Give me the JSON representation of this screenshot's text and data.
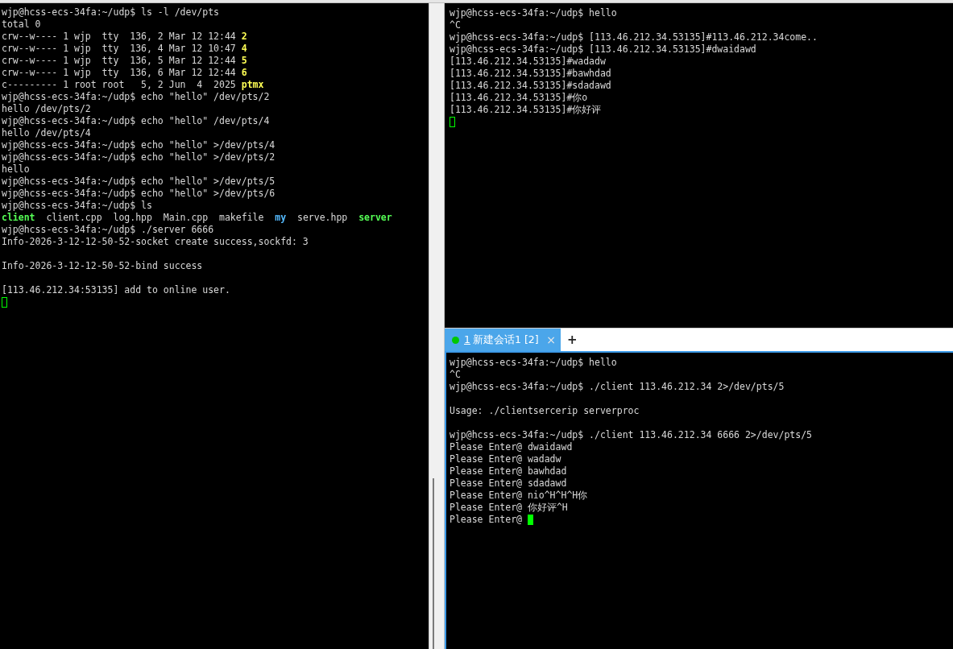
{
  "panes": [
    {
      "lines": [
        {
          "kind": "text",
          "text": "wjp@hcss-ecs-34fa:~/udp$ ls -l /dev/pts"
        },
        {
          "kind": "text",
          "text": "total 0"
        },
        {
          "kind": "segments",
          "segments": [
            {
              "text": "crw--w---- 1 wjp  tty  136, 2 Mar 12 12:44 ",
              "kind": "plain"
            },
            {
              "text": "2",
              "kind": "device"
            }
          ]
        },
        {
          "kind": "segments",
          "segments": [
            {
              "text": "crw--w---- 1 wjp  tty  136, 4 Mar 12 10:47 ",
              "kind": "plain"
            },
            {
              "text": "4",
              "kind": "device"
            }
          ]
        },
        {
          "kind": "segments",
          "segments": [
            {
              "text": "crw--w---- 1 wjp  tty  136, 5 Mar 12 12:44 ",
              "kind": "plain"
            },
            {
              "text": "5",
              "kind": "device"
            }
          ]
        },
        {
          "kind": "segments",
          "segments": [
            {
              "text": "crw--w---- 1 wjp  tty  136, 6 Mar 12 12:44 ",
              "kind": "plain"
            },
            {
              "text": "6",
              "kind": "device"
            }
          ]
        },
        {
          "kind": "segments",
          "segments": [
            {
              "text": "c--------- 1 root root   5, 2 Jun  4  2025 ",
              "kind": "plain"
            },
            {
              "text": "ptmx",
              "kind": "device"
            }
          ]
        },
        {
          "kind": "text",
          "text": "wjp@hcss-ecs-34fa:~/udp$ echo \"hello\" /dev/pts/2"
        },
        {
          "kind": "text",
          "text": "hello /dev/pts/2"
        },
        {
          "kind": "text",
          "text": "wjp@hcss-ecs-34fa:~/udp$ echo \"hello\" /dev/pts/4"
        },
        {
          "kind": "text",
          "text": "hello /dev/pts/4"
        },
        {
          "kind": "text",
          "text": "wjp@hcss-ecs-34fa:~/udp$ echo \"hello\" >/dev/pts/4"
        },
        {
          "kind": "text",
          "text": "wjp@hcss-ecs-34fa:~/udp$ echo \"hello\" >/dev/pts/2"
        },
        {
          "kind": "text",
          "text": "hello"
        },
        {
          "kind": "text",
          "text": "wjp@hcss-ecs-34fa:~/udp$ echo \"hello\" >/dev/pts/5"
        },
        {
          "kind": "text",
          "text": "wjp@hcss-ecs-34fa:~/udp$ echo \"hello\" >/dev/pts/6"
        },
        {
          "kind": "text",
          "text": "wjp@hcss-ecs-34fa:~/udp$ ls"
        },
        {
          "kind": "segments",
          "segments": [
            {
              "text": "client",
              "kind": "executable"
            },
            {
              "text": "  client.cpp  log.hpp  Main.cpp  makefile  ",
              "kind": "plain"
            },
            {
              "text": "my",
              "kind": "directory"
            },
            {
              "text": "  serve.hpp  ",
              "kind": "plain"
            },
            {
              "text": "server",
              "kind": "executable"
            }
          ]
        },
        {
          "kind": "text",
          "text": "wjp@hcss-ecs-34fa:~/udp$ ./server 6666"
        },
        {
          "kind": "text",
          "text": "Info-2026-3-12-12-50-52-socket create success,sockfd: 3"
        },
        {
          "kind": "blank"
        },
        {
          "kind": "text",
          "text": "Info-2026-3-12-12-50-52-bind success"
        },
        {
          "kind": "blank"
        },
        {
          "kind": "text",
          "text": "[113.46.212.34:53135] add to online user."
        },
        {
          "kind": "cursor",
          "filled": false
        }
      ]
    },
    {
      "lines": [
        {
          "kind": "text",
          "text": "wjp@hcss-ecs-34fa:~/udp$ hello"
        },
        {
          "kind": "text",
          "text": "^C"
        },
        {
          "kind": "text",
          "text": "wjp@hcss-ecs-34fa:~/udp$ [113.46.212.34.53135]#113.46.212.34come.."
        },
        {
          "kind": "text",
          "text": "wjp@hcss-ecs-34fa:~/udp$ [113.46.212.34.53135]#dwaidawd"
        },
        {
          "kind": "text",
          "text": "[113.46.212.34.53135]#wadadw"
        },
        {
          "kind": "text",
          "text": "[113.46.212.34.53135]#bawhdad"
        },
        {
          "kind": "text",
          "text": "[113.46.212.34.53135]#sdadawd"
        },
        {
          "kind": "text",
          "text": "[113.46.212.34.53135]#你o"
        },
        {
          "kind": "text",
          "text": "[113.46.212.34.53135]#你好评"
        },
        {
          "kind": "cursor",
          "filled": false
        }
      ]
    },
    {
      "tab": {
        "number": "1",
        "label": "新建会话1 [2]",
        "connected": true,
        "selected": true,
        "close": "×"
      },
      "new_tab": "+",
      "lines": [
        {
          "kind": "text",
          "text": "wjp@hcss-ecs-34fa:~/udp$ hello"
        },
        {
          "kind": "text",
          "text": "^C"
        },
        {
          "kind": "text",
          "text": "wjp@hcss-ecs-34fa:~/udp$ ./client 113.46.212.34 2>/dev/pts/5"
        },
        {
          "kind": "blank"
        },
        {
          "kind": "text",
          "text": "Usage: ./clientsercerip serverproc"
        },
        {
          "kind": "blank"
        },
        {
          "kind": "text",
          "text": "wjp@hcss-ecs-34fa:~/udp$ ./client 113.46.212.34 6666 2>/dev/pts/5"
        },
        {
          "kind": "text",
          "text": "Please Enter@ dwaidawd"
        },
        {
          "kind": "text",
          "text": "Please Enter@ wadadw"
        },
        {
          "kind": "text",
          "text": "Please Enter@ bawhdad"
        },
        {
          "kind": "text",
          "text": "Please Enter@ sdadawd"
        },
        {
          "kind": "text",
          "text": "Please Enter@ nio^H^H^H你"
        },
        {
          "kind": "text",
          "text": "Please Enter@ 你好评^H"
        },
        {
          "kind": "prompt",
          "text": "Please Enter@",
          "filled": true
        }
      ]
    }
  ]
}
